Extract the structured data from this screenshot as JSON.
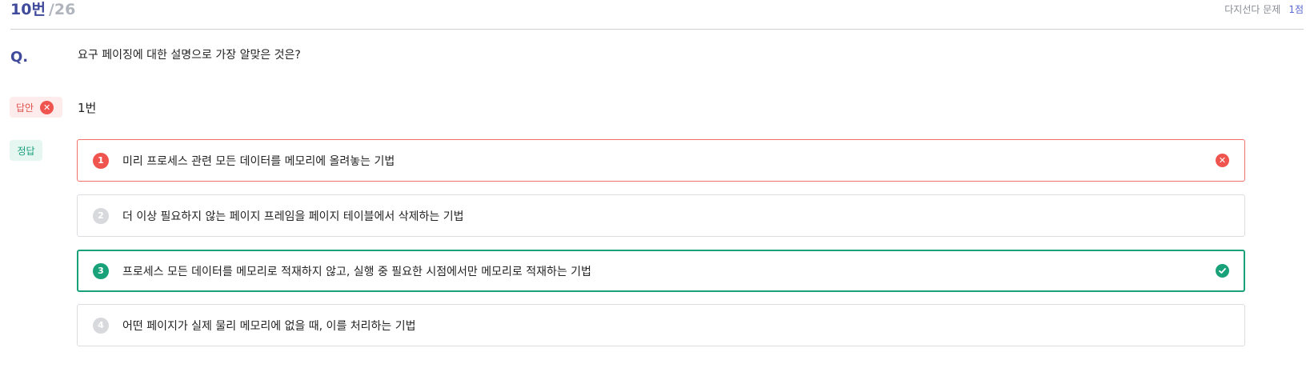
{
  "header": {
    "number": "10번",
    "total": "/26",
    "type": "다지선다 문제",
    "points": "1점"
  },
  "question": {
    "label": "Q.",
    "text": "요구 페이징에 대한 설명으로 가장 알맞은 것은?"
  },
  "answer": {
    "label": "답안",
    "value": "1번",
    "status_icon": "x-circle-icon"
  },
  "correct": {
    "label": "정답"
  },
  "options": [
    {
      "num": "1",
      "text": "미리 프로세스 관련 모든 데이터를 메모리에 올려놓는 기법",
      "state": "wrong"
    },
    {
      "num": "2",
      "text": "더 이상 필요하지 않는 페이지 프레임을 페이지 테이블에서 삭제하는 기법",
      "state": "none"
    },
    {
      "num": "3",
      "text": "프로세스 모든 데이터를 메모리로 적재하지 않고, 실행 중 필요한 시점에서만 메모리로 적재하는 기법",
      "state": "right"
    },
    {
      "num": "4",
      "text": "어떤 페이지가 실제 물리 메모리에 없을 때, 이를 처리하는 기법",
      "state": "none"
    }
  ],
  "colors": {
    "accent": "#3f4a9b",
    "wrong": "#f0544f",
    "right": "#19a17a"
  }
}
